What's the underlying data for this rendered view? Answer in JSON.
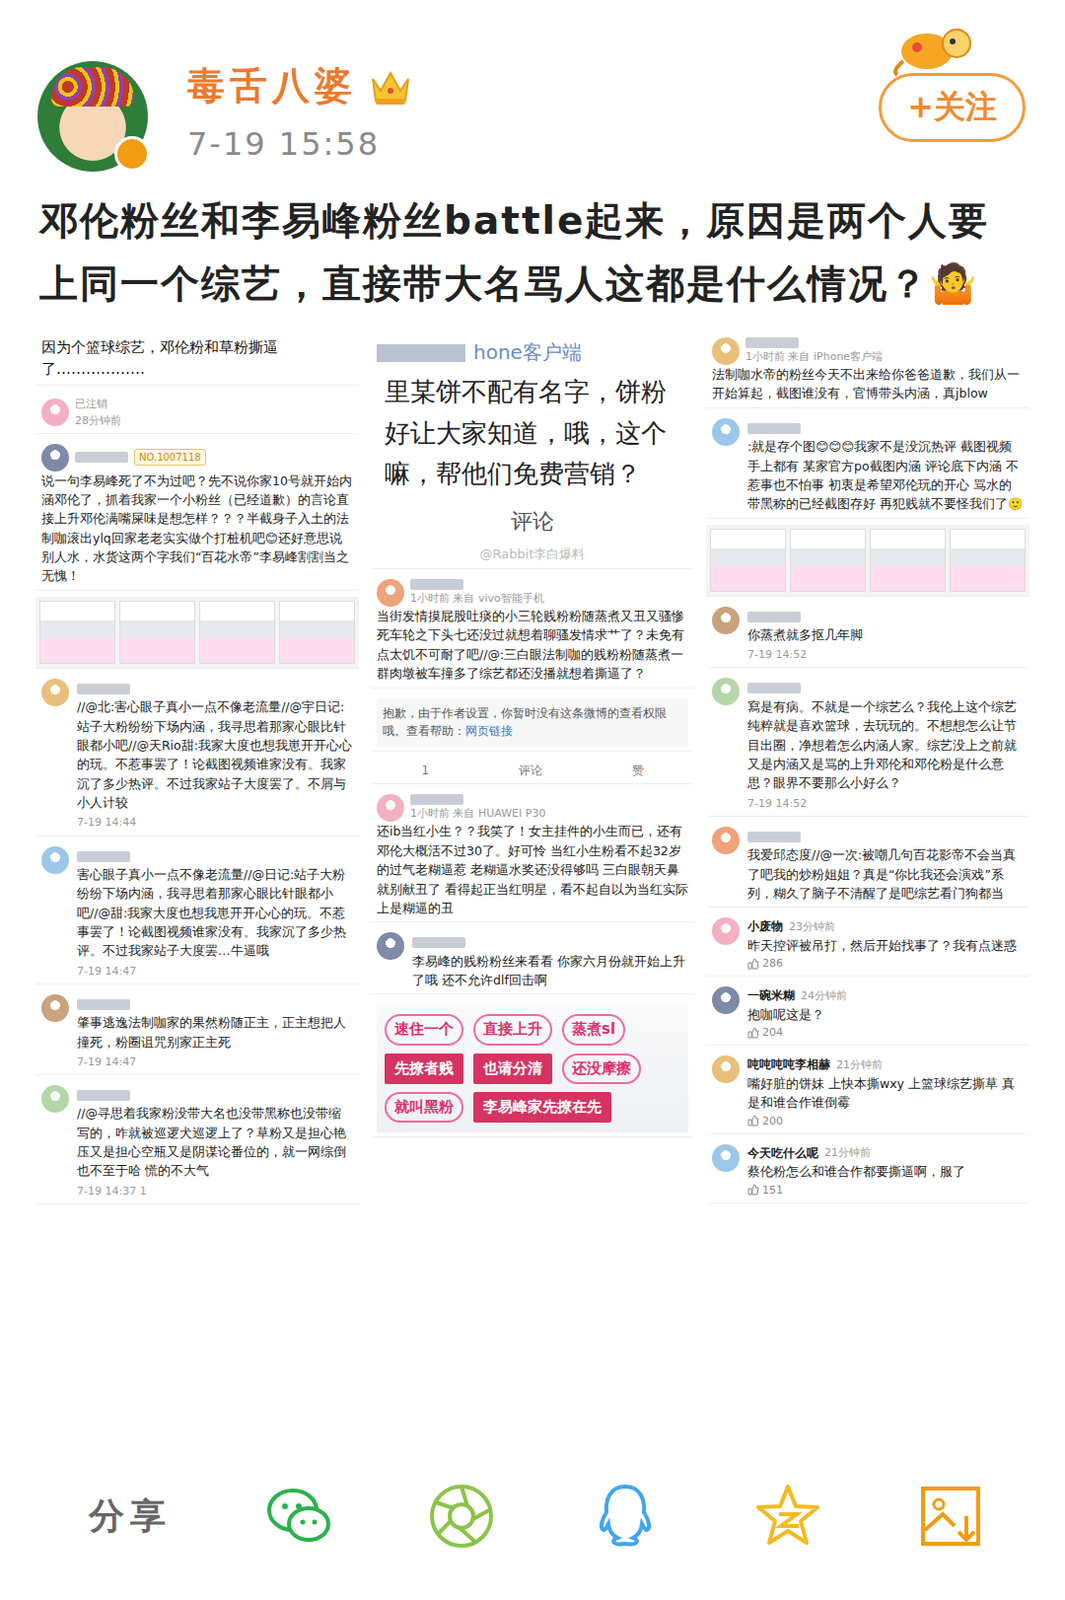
{
  "post": {
    "author": "毒舌八婆",
    "time": "7-19 15:58",
    "follow": "+关注",
    "text": "邓伦粉丝和李易峰粉丝battle起来，原因是两个人要上同一个综艺，直接带大名骂人这都是什么情况？",
    "emoji": "🤷"
  },
  "collage": {
    "columns": [
      {
        "items": [
          {
            "kind": "title",
            "text": "因为个篮球综艺，邓伦粉和草粉撕逼了………………"
          },
          {
            "kind": "user",
            "name": "已注销",
            "meta": "28分钟前"
          },
          {
            "kind": "post",
            "meta": "",
            "badge": "NO.1007118",
            "text": "说一句李易峰死了不为过吧？先不说你家10号就开始内涵邓伦了，抓着我家一个小粉丝（已经道歉）的言论直接上升邓伦满嘴屎味是想怎样？？？半截身子入土的法制咖滚出ylq回家老老实实做个打桩机吧😊还好意思说别人水，水货这两个字我们“百花水帝”李易峰割割当之无愧！"
          },
          {
            "kind": "shot"
          },
          {
            "kind": "comment",
            "text": "//@北:害心眼子真小一点不像老流量//@宇日记:站子大粉纷纷下场内涵，我寻思着那家心眼比针眼都小吧//@天Rio甜:我家大度也想我崽开开心心的玩。不惹事罢了！论截图视频谁家没有。我家沉了多少热评。不过我家站子大度罢了。不屑与小人计较",
            "time": "7-19 14:44"
          },
          {
            "kind": "comment",
            "text": "害心眼子真小一点不像老流量//@日记:站子大粉纷纷下场内涵，我寻思着那家心眼比针眼都小吧//@甜:我家大度也想我崽开开心心的玩。不惹事罢了！论截图视频谁家没有。我家沉了多少热评。不过我家站子大度罢…牛逼哦",
            "time": "7-19 14:47"
          },
          {
            "kind": "comment",
            "text": "肇事逃逸法制咖家的果然粉随正主，正主想把人撞死，粉圈诅咒别家正主死",
            "time": "7-19 14:47"
          },
          {
            "kind": "comment",
            "text": "//@寻思着我家粉没带大名也没带黑称也没带缩写的，咋就被巡逻犬巡逻上了？草粉又是担心艳压又是担心空瓶又是阴谋论番位的，就一网综倒也不至于哈 慌的不大气",
            "time": "7-19 14:37  1"
          }
        ]
      },
      {
        "items": [
          {
            "kind": "bigtext",
            "source": "hone客户端",
            "lines": [
              "里某饼不配有名字，饼粉",
              "好让大家知道，哦，这个",
              "嘛，帮他们免费营销？"
            ],
            "action": "评论",
            "watermark": "@Rabbit李白爆料"
          },
          {
            "kind": "post",
            "meta": "1小时前 来自 vivo智能手机",
            "badge": "",
            "text": "当街发情摸屁股吐痰的小三轮贱粉粉随蒸煮又丑又骚惨死车轮之下头七还没过就想着聊骚发情求艹了？未免有点太饥不可耐了吧//@:三白眼法制咖的贱粉粉随蒸煮一群肉墩被车撞多了综艺都还没播就想着撕逼了？"
          },
          {
            "kind": "notice",
            "text": "抱歉，由于作者设置，你暂时没有这条微博的查看权限哦。查看帮助：",
            "link": "网页链接"
          },
          {
            "kind": "actions",
            "items": [
              "1",
              "评论",
              "赞"
            ]
          },
          {
            "kind": "post",
            "meta": "1小时前 来自 HUAWEI P30",
            "badge": "",
            "text": "还ib当红小生？？我笑了！女主挂件的小生而已，还有邓伦大概活不过30了。好可怜 当红小生粉看不起32岁的过气老糊逼惹 老糊逼水奖还没得够吗 三白眼朝天鼻就别献丑了 看得起正当红明星，看不起自以为当红实际上是糊逼的丑"
          },
          {
            "kind": "comment",
            "text": "李易峰的贱粉粉丝来看看 你家六月份就开始上升了哦 还不允许dlf回击啊",
            "time": ""
          },
          {
            "kind": "annotated",
            "notes": [
              {
                "text": "速住一个",
                "boxed": false
              },
              {
                "text": "直接上升",
                "boxed": false
              },
              {
                "text": "蒸煮sl",
                "boxed": false
              },
              {
                "text": "先撩者贱",
                "boxed": true
              },
              {
                "text": "也请分清",
                "boxed": true
              },
              {
                "text": "还没摩擦",
                "boxed": false
              },
              {
                "text": "就叫黑粉",
                "boxed": false
              },
              {
                "text": "李易峰家先撩在先",
                "boxed": true
              }
            ]
          }
        ]
      },
      {
        "items": [
          {
            "kind": "post",
            "meta": "1小时前 来自 iPhone客户端",
            "badge": "",
            "text": "法制咖水帝的粉丝今天不出来给你爸爸道歉，我们从一开始算起，截图谁没有，官博带头内涵，真jblow"
          },
          {
            "kind": "comment",
            "text": ":就是存个图😊😊😊我家不是没沉热评 截图视频手上都有 某家官方po截图内涵 评论底下内涵 不惹事也不怕事 初衷是希望邓伦玩的开心 骂水的 带黑称的已经截图存好 再犯贱就不要怪我们了🙂",
            "time": ""
          },
          {
            "kind": "shot"
          },
          {
            "kind": "comment",
            "text": "你蒸煮就多抠几年脚",
            "time": "7-19 14:52"
          },
          {
            "kind": "comment",
            "text": "寫是有病。不就是一个综艺么？我伦上这个综艺纯粹就是喜欢篮球，去玩玩的。不想想怎么让节目出圈，净想着怎么内涵人家。综艺没上之前就又是内涵又是骂的上升邓伦和邓伦粉是什么意思？眼界不要那么小好么？",
            "time": "7-19 14:52"
          },
          {
            "kind": "comment",
            "text": "我爱邱态度//@一次:被嘲几句百花影帝不会当真了吧我的炒粉姐姐？真是“你比我还会演戏”系列，糊久了脑子不清醒了是吧综艺看门狗都当",
            "time": ""
          },
          {
            "kind": "reply",
            "name": "小废物",
            "meta": "23分钟前",
            "text": "昨天控评被吊打，然后开始找事了？我有点迷惑",
            "likes": "286"
          },
          {
            "kind": "reply",
            "name": "一碗米糊",
            "meta": "24分钟前",
            "text": "抱咖呢这是？",
            "likes": "204"
          },
          {
            "kind": "reply",
            "name": "吨吨吨吨李相赫",
            "meta": "21分钟前",
            "text": "嘴好脏的饼妹 上快本撕wxy 上篮球综艺撕草 真是和谁合作谁倒霉",
            "likes": "200"
          },
          {
            "kind": "reply",
            "name": "今天吃什么呢",
            "meta": "21分钟前",
            "text": "蔡伦粉怎么和谁合作都要撕逼啊，服了",
            "likes": "151"
          }
        ]
      }
    ]
  },
  "share": {
    "label": "分享"
  }
}
